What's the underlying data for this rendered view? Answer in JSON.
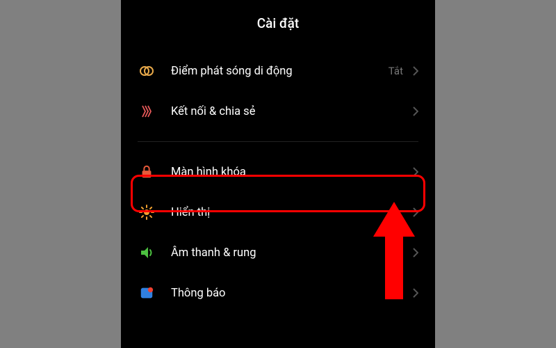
{
  "header": {
    "title": "Cài đặt"
  },
  "items": [
    {
      "label": "Điểm phát sóng di động",
      "value": "Tắt",
      "icon": "hotspot-icon",
      "color": "#e8a94a"
    },
    {
      "label": "Kết nối & chia sẻ",
      "value": null,
      "icon": "connection-icon",
      "color": "#e85a5a"
    },
    {
      "label": "Màn hình khóa",
      "value": null,
      "icon": "lock-icon",
      "color": "#e85a3a"
    },
    {
      "label": "Hiển thị",
      "value": null,
      "icon": "brightness-icon",
      "color": "#f0a030"
    },
    {
      "label": "Âm thanh & rung",
      "value": null,
      "icon": "sound-icon",
      "color": "#4cc040"
    },
    {
      "label": "Thông báo",
      "value": null,
      "icon": "notification-icon",
      "color": "#3080e0"
    }
  ]
}
